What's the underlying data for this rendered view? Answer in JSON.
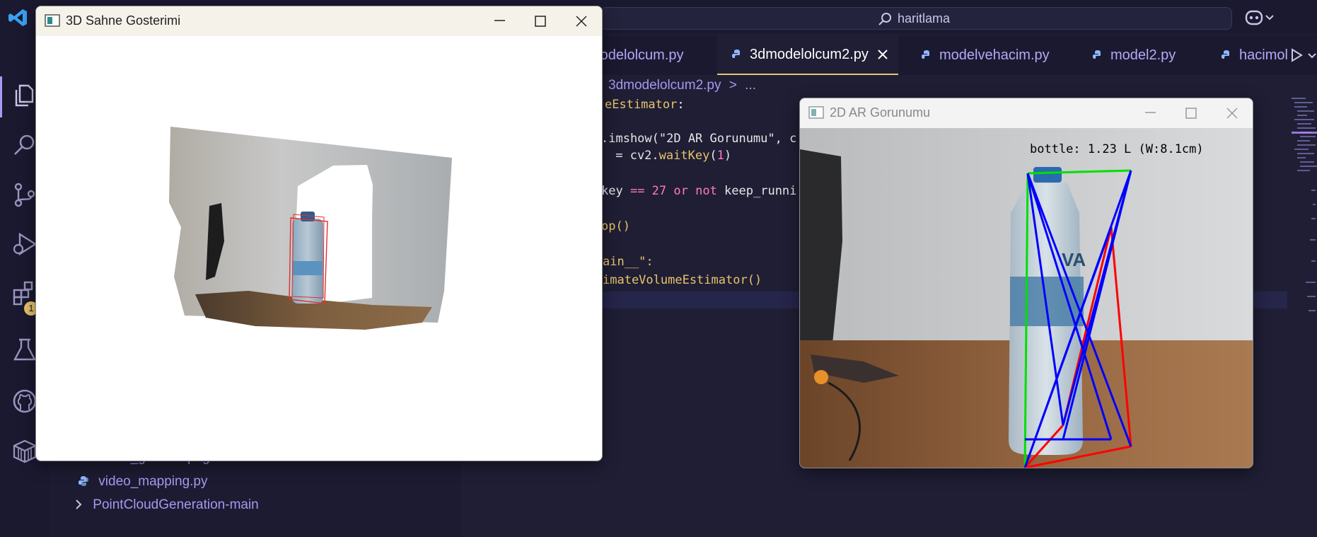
{
  "command_center": {
    "text": "haritlama"
  },
  "tabs": [
    {
      "label": "modelolcum.py"
    },
    {
      "label": "3dmodelolcum2.py",
      "active": true
    },
    {
      "label": "modelvehacim.py"
    },
    {
      "label": "model2.py"
    },
    {
      "label": "hacimol"
    }
  ],
  "breadcrumb": {
    "file": "3dmodelolcum2.py",
    "sep": ">",
    "more": "..."
  },
  "activity_bar": {
    "icons": [
      "explorer-icon",
      "search-icon",
      "source-control-icon",
      "run-debug-icon",
      "extensions-icon",
      "testing-icon",
      "github-icon",
      "containers-icon"
    ],
    "extensions_badge": "1"
  },
  "explorer": {
    "items": [
      {
        "label": "renkli_goruntu.png",
        "type": "file"
      },
      {
        "label": "video_mapping.py",
        "type": "file"
      },
      {
        "label": "PointCloudGeneration-main",
        "type": "folder"
      }
    ]
  },
  "code": {
    "lines": [
      [
        {
          "t": "eEstimator",
          "c": "#e9c46a"
        },
        {
          "t": ":",
          "c": "#ffffff"
        }
      ],
      [
        {
          "t": ".imshow(\"2D AR Gorunumu\", c",
          "c": "#e6e6e6"
        }
      ],
      [
        {
          "t": " = cv2.",
          "c": "#e6e6e6"
        },
        {
          "t": "waitKey",
          "c": "#e9c46a"
        },
        {
          "t": "(",
          "c": "#e6e6e6"
        },
        {
          "t": "1",
          "c": "#ff79c6"
        },
        {
          "t": ")",
          "c": "#e6e6e6"
        }
      ],
      [
        {
          "t": "key ",
          "c": "#e6e6e6"
        },
        {
          "t": "==",
          "c": "#ff79c6"
        },
        {
          "t": " 27 ",
          "c": "#ff79c6"
        },
        {
          "t": "or not",
          "c": "#ff79c6"
        },
        {
          "t": " keep_runni",
          "c": "#e6e6e6"
        }
      ],
      [
        {
          "t": "op()",
          "c": "#e9c46a"
        }
      ],
      [
        {
          "t": "ain__\":",
          "c": "#e9c46a"
        }
      ],
      [
        {
          "t": "imateVolumeEstimator()",
          "c": "#e9c46a"
        }
      ]
    ]
  },
  "window_3d": {
    "title": "3D Sahne Gosterimi"
  },
  "window_2d": {
    "title": "2D AR Gorunumu",
    "overlay_label": "bottle: 1.23 L (W:8.1cm)",
    "bottle_brand": "VA"
  },
  "colors": {
    "accent": "#a99bf3",
    "tab_active_border": "#e9c46a",
    "box_green": "#00e000",
    "box_red": "#ff0000",
    "box_blue": "#0000ff"
  }
}
